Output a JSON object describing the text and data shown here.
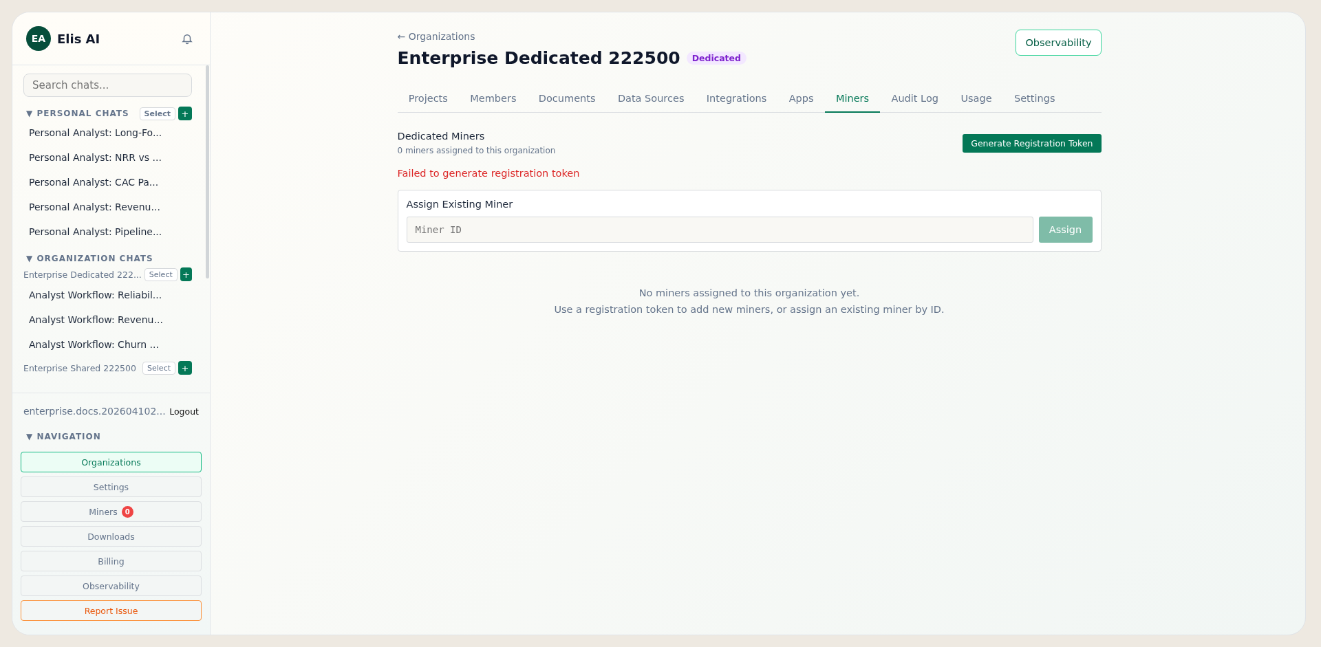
{
  "sidebar": {
    "avatar": "EA",
    "brand": "Elis AI",
    "search": {
      "placeholder": "Search chats..."
    },
    "personal": {
      "title": "▼ PERSONAL CHATS",
      "select": "Select",
      "add": "+",
      "items": [
        "Personal Analyst: Long-Fo...",
        "Personal Analyst: NRR vs ...",
        "Personal Analyst: CAC Pa...",
        "Personal Analyst: Revenu...",
        "Personal Analyst: Pipeline..."
      ]
    },
    "organization": {
      "title": "▼ ORGANIZATION CHATS",
      "groups": [
        {
          "name": "Enterprise Dedicated 222...",
          "select": "Select",
          "add": "+",
          "items": [
            "Analyst Workflow: Reliabil...",
            "Analyst Workflow: Revenu...",
            "Analyst Workflow: Churn ..."
          ]
        },
        {
          "name": "Enterprise Shared 222500",
          "select": "Select",
          "add": "+"
        }
      ]
    },
    "user": "enterprise.docs.202604102...",
    "logout": "Logout",
    "navigation": {
      "title": "▼ NAVIGATION",
      "items": [
        {
          "label": "Organizations",
          "kind": "link",
          "selected": true
        },
        {
          "label": "Settings",
          "kind": "link",
          "selected": false
        },
        {
          "label": "Miners",
          "kind": "link",
          "selected": false,
          "badge": "0"
        },
        {
          "label": "Downloads",
          "kind": "link",
          "selected": false
        },
        {
          "label": "Billing",
          "kind": "link",
          "selected": false
        },
        {
          "label": "Observability",
          "kind": "link",
          "selected": false
        },
        {
          "label": "Report Issue",
          "kind": "report",
          "selected": false
        }
      ]
    }
  },
  "main": {
    "back": "← Organizations",
    "title": "Enterprise Dedicated 222500",
    "tag": "Dedicated",
    "observability": "Observability",
    "tabs": [
      {
        "label": "Projects",
        "selected": false
      },
      {
        "label": "Members",
        "selected": false
      },
      {
        "label": "Documents",
        "selected": false
      },
      {
        "label": "Data Sources",
        "selected": false
      },
      {
        "label": "Integrations",
        "selected": false
      },
      {
        "label": "Apps",
        "selected": false
      },
      {
        "label": "Miners",
        "selected": true
      },
      {
        "label": "Audit Log",
        "selected": false
      },
      {
        "label": "Usage",
        "selected": false
      },
      {
        "label": "Settings",
        "selected": false
      }
    ],
    "section_title": "Dedicated Miners",
    "section_sub": "0 miners assigned to this organization",
    "generate": "Generate Registration Token",
    "error": "Failed to generate registration token",
    "assign": {
      "title": "Assign Existing Miner",
      "placeholder": "Miner ID",
      "button": "Assign",
      "disabled": true
    },
    "empty": [
      "No miners assigned to this organization yet.",
      "Use a registration token to add new miners, or assign an existing miner by ID."
    ]
  }
}
